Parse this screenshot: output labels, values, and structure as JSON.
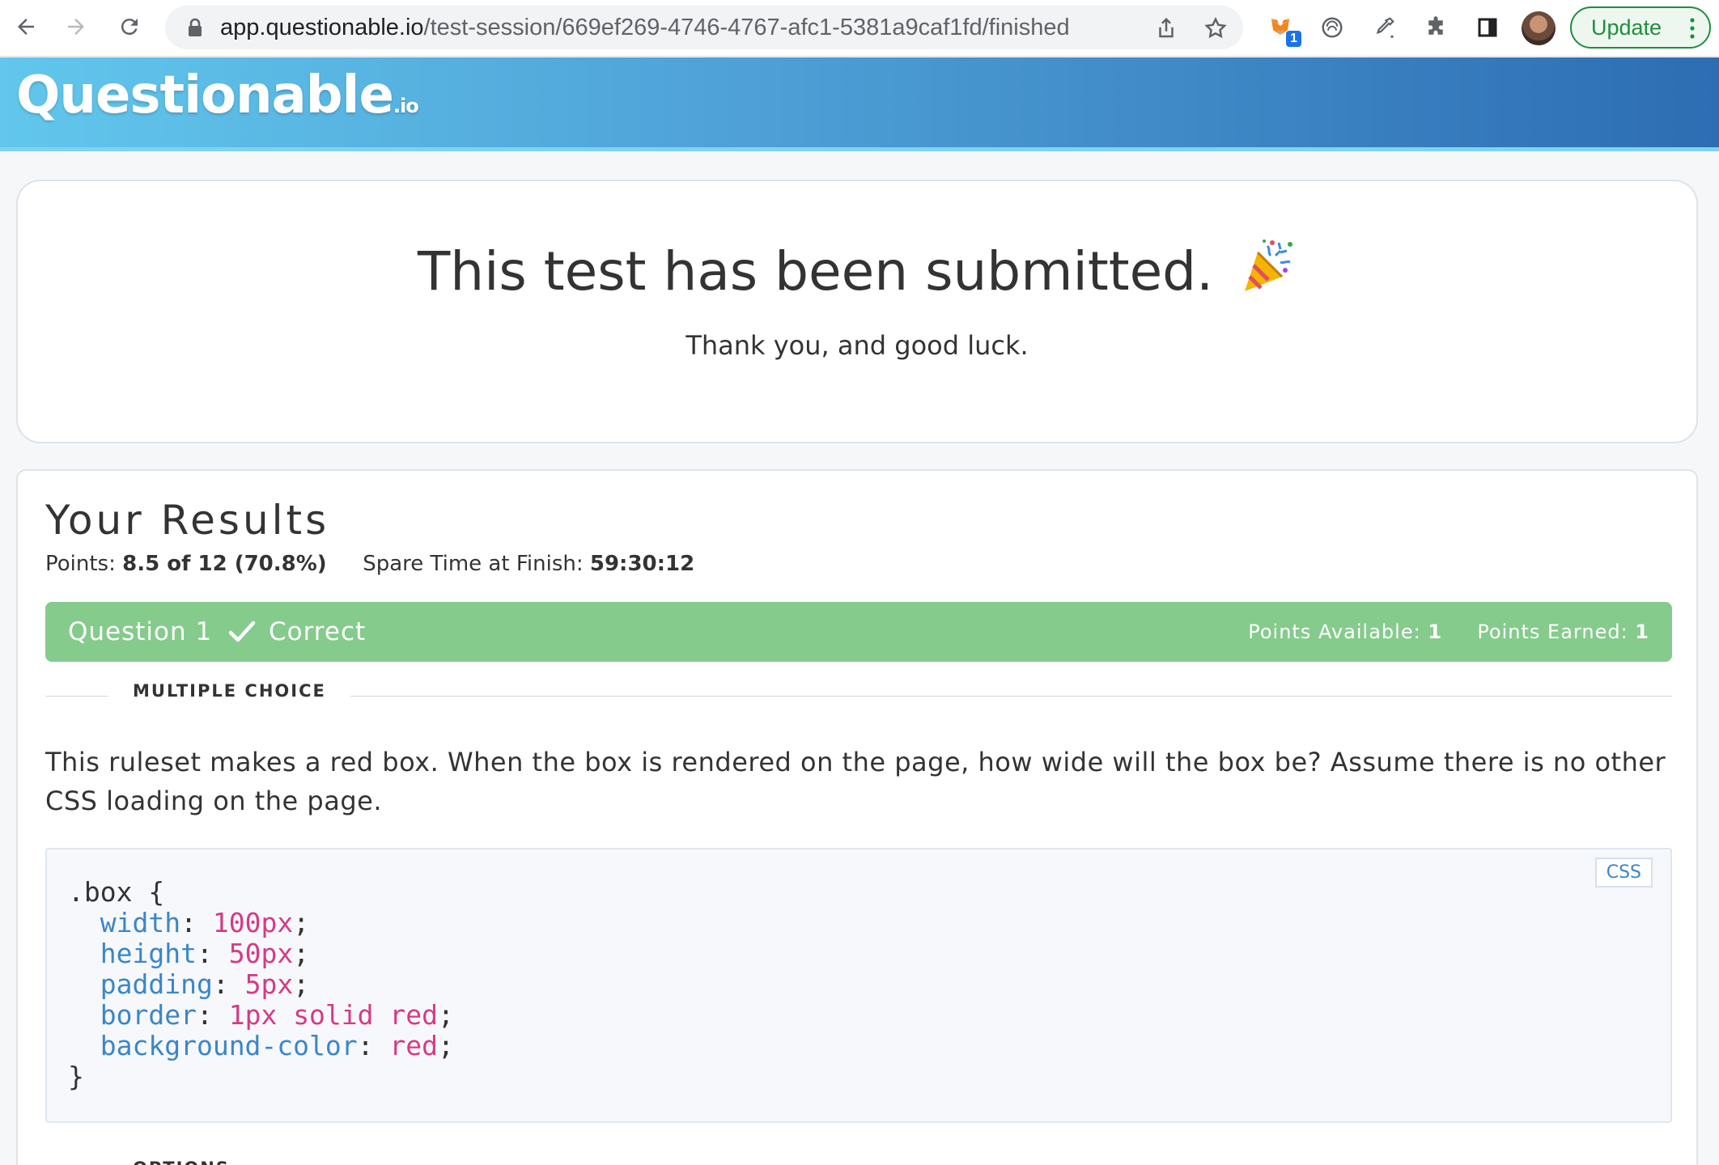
{
  "browser": {
    "url_host": "app.questionable.io",
    "url_path": "/test-session/669ef269-4746-4767-afc1-5381a9caf1fd/finished",
    "extension_badge": "1",
    "update_label": "Update"
  },
  "app": {
    "logo": "Questionable",
    "logo_suffix": ".io"
  },
  "submitted": {
    "title": "This test has been submitted.",
    "subtitle": "Thank you, and good luck."
  },
  "results": {
    "heading": "Your Results",
    "points_label": "Points:",
    "points_value": "8.5 of 12 (70.8%)",
    "spare_time_label": "Spare Time at Finish:",
    "spare_time_value": "59:30:12"
  },
  "question": {
    "title": "Question 1",
    "status": "Correct",
    "points_available_label": "Points Available:",
    "points_available_value": "1",
    "points_earned_label": "Points Earned:",
    "points_earned_value": "1",
    "type_label": "MULTIPLE CHOICE",
    "text": "This ruleset makes a red box. When the box is rendered on the page, how wide will the box be? Assume there is no other CSS loading on the page.",
    "code_lang": "CSS",
    "code": {
      "selector": ".box {",
      "lines": [
        {
          "prop": "width",
          "value": "100px"
        },
        {
          "prop": "height",
          "value": "50px"
        },
        {
          "prop": "padding",
          "value": "5px"
        },
        {
          "prop": "border",
          "value": "1px solid red"
        },
        {
          "prop": "background-color",
          "value": "red"
        }
      ],
      "close": "}"
    },
    "options_label": "OPTIONS"
  },
  "colors": {
    "correct_bar": "#85cb8c",
    "header_start": "#62c7ec",
    "header_end": "#2d6db3",
    "code_prop": "#3b86c9",
    "code_value": "#d63a86"
  }
}
